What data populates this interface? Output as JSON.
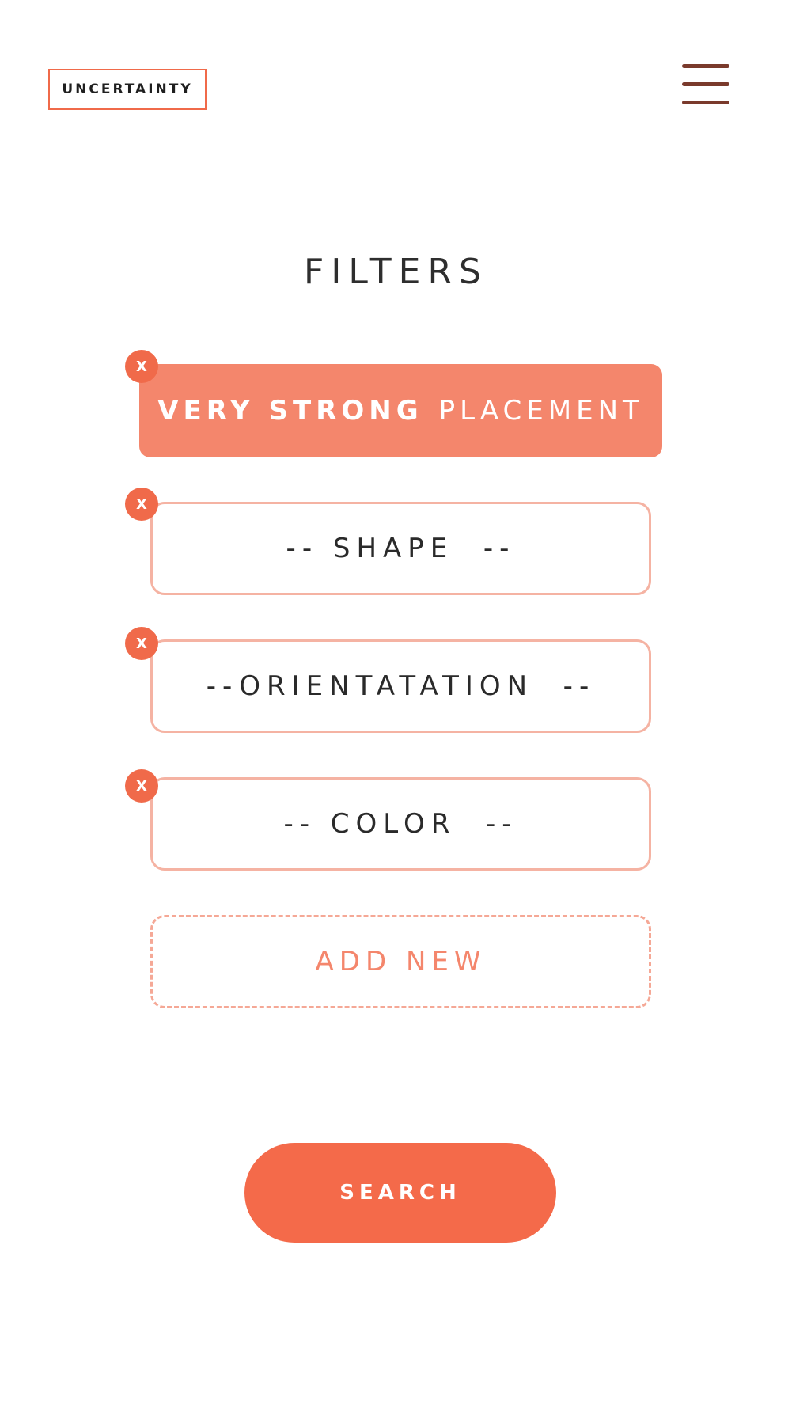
{
  "header": {
    "logo_text": "UNCERTAINTY",
    "menu_icon": "hamburger-menu-icon"
  },
  "page": {
    "title": "FILTERS"
  },
  "filters": [
    {
      "strong": "VERY STRONG",
      "label": "PLACEMENT",
      "active": true
    },
    {
      "label": "-- SHAPE  --",
      "active": false
    },
    {
      "label": "--ORIENTATATION  --",
      "active": false
    },
    {
      "label": "-- COLOR  --",
      "active": false
    }
  ],
  "remove_label": "X",
  "add_new_label": "ADD NEW",
  "search_label": "SEARCH",
  "colors": {
    "accent": "#f46a4a",
    "active_fill": "#f4866c",
    "outline": "#f5b3a3",
    "menu": "#7a3a2c"
  }
}
